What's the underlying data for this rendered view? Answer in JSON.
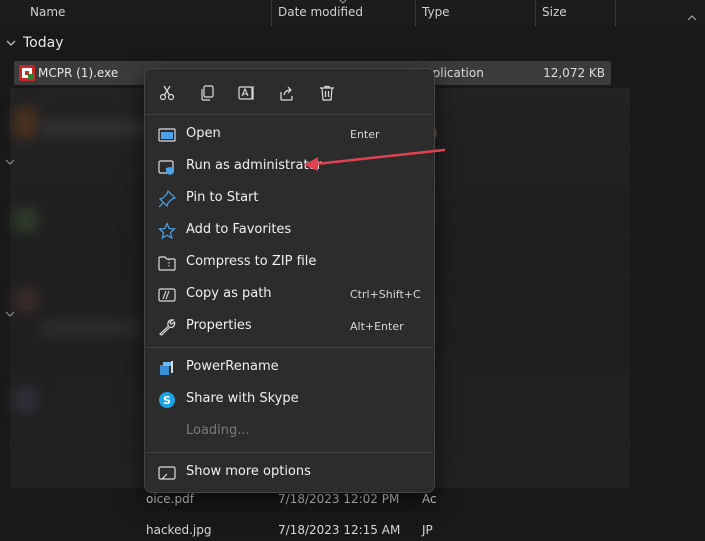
{
  "columns": {
    "name": "Name",
    "date_modified": "Date modified",
    "type": "Type",
    "size": "Size"
  },
  "group": {
    "label": "Today"
  },
  "selected_file": {
    "name": "MCPR (1).exe",
    "type": "pplication",
    "size": "12,072 KB"
  },
  "bottom_files": [
    {
      "name": "oice.pdf",
      "date": "7/18/2023 12:02 PM",
      "type": "Ac"
    },
    {
      "name": "hacked.jpg",
      "date": "7/18/2023 12:15 AM",
      "type": "JP"
    }
  ],
  "context_menu": {
    "quick_actions": [
      "cut-icon",
      "copy-icon",
      "rename-icon",
      "share-icon",
      "delete-icon"
    ],
    "items": [
      {
        "label": "Open",
        "shortcut": "Enter",
        "icon": "open-app-icon"
      },
      {
        "label": "Run as administrator",
        "shortcut": "",
        "icon": "shield-admin-icon"
      },
      {
        "label": "Pin to Start",
        "shortcut": "",
        "icon": "pin-icon"
      },
      {
        "label": "Add to Favorites",
        "shortcut": "",
        "icon": "star-icon"
      },
      {
        "label": "Compress to ZIP file",
        "shortcut": "",
        "icon": "zip-folder-icon"
      },
      {
        "label": "Copy as path",
        "shortcut": "Ctrl+Shift+C",
        "icon": "copy-path-icon"
      },
      {
        "label": "Properties",
        "shortcut": "Alt+Enter",
        "icon": "wrench-icon"
      }
    ],
    "extensions": [
      {
        "label": "PowerRename",
        "icon": "powerrename-icon"
      },
      {
        "label": "Share with Skype",
        "icon": "skype-icon"
      },
      {
        "label": "Loading...",
        "icon": ""
      }
    ],
    "more": {
      "label": "Show more options",
      "icon": "more-options-icon"
    }
  },
  "colors": {
    "accent": "#4aa3e8",
    "arrow": "#e0434f"
  }
}
